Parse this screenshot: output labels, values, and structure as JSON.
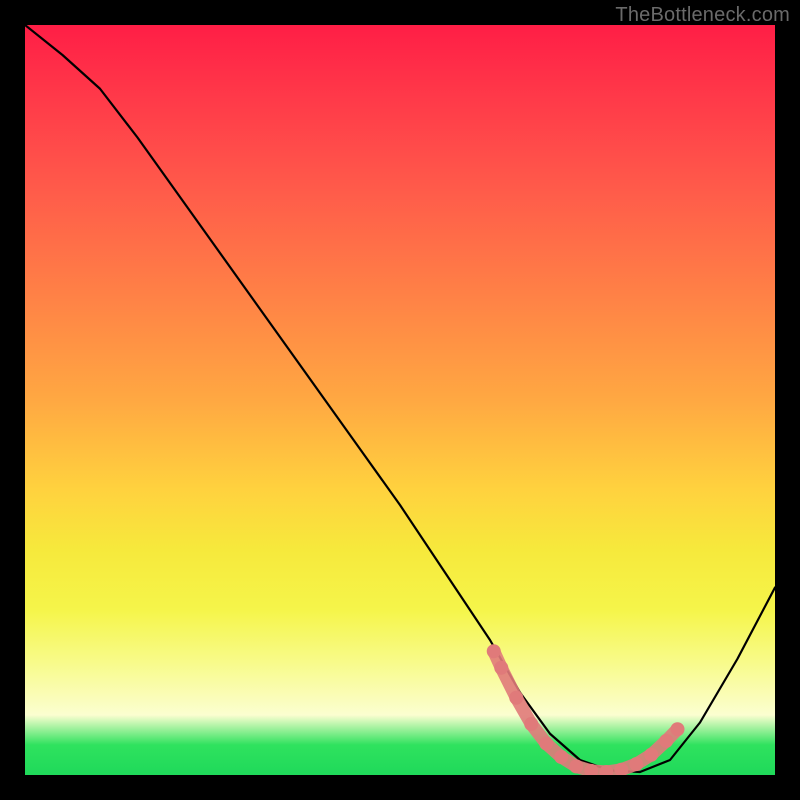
{
  "watermark": "TheBottleneck.com",
  "chart_data": {
    "type": "line",
    "title": "",
    "xlabel": "",
    "ylabel": "",
    "xlim": [
      0,
      100
    ],
    "ylim": [
      0,
      100
    ],
    "grid": false,
    "legend": false,
    "series": [
      {
        "name": "bottleneck-curve",
        "color": "#000000",
        "x": [
          0,
          5,
          10,
          15,
          20,
          25,
          30,
          35,
          40,
          45,
          50,
          55,
          60,
          62,
          66,
          70,
          74,
          78,
          82,
          86,
          90,
          95,
          100
        ],
        "y": [
          100,
          96,
          91.5,
          85,
          78,
          71,
          64,
          57,
          50,
          43,
          36,
          28.5,
          21,
          18,
          11,
          5.5,
          2,
          0.6,
          0.4,
          2,
          7,
          15.5,
          25
        ]
      },
      {
        "name": "optimal-range-marker",
        "color": "#e07a7a",
        "type": "scatter",
        "x": [
          62.5,
          63.5,
          65.5,
          67.5,
          69.5,
          71.5,
          73.5,
          75.5,
          77.5,
          79.5,
          81.5,
          83.5,
          85.5,
          87
        ],
        "y": [
          16.5,
          14.3,
          10.3,
          6.8,
          4.2,
          2.4,
          1.15,
          0.55,
          0.4,
          0.7,
          1.45,
          2.7,
          4.55,
          6.1
        ]
      }
    ],
    "annotations": []
  }
}
